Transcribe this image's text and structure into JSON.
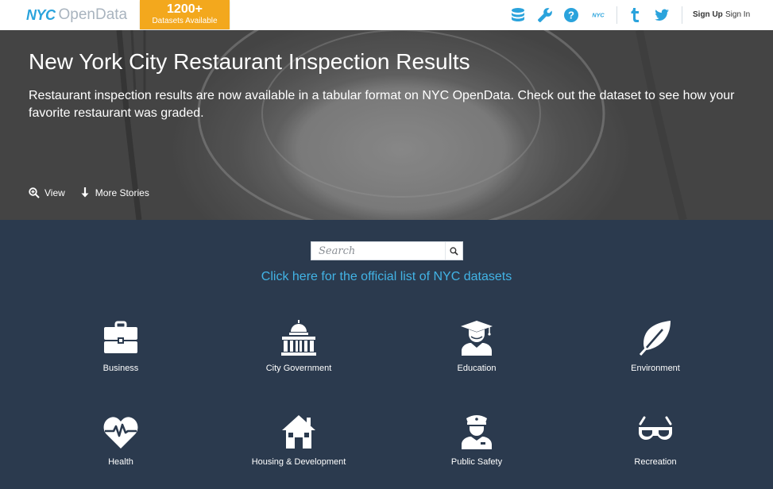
{
  "header": {
    "logo_nyc": "NYC",
    "logo_opendata": "OpenData",
    "ribbon_count": "1200+",
    "ribbon_label": "Datasets Available",
    "sign_up": "Sign Up",
    "sign_in": "Sign In",
    "icons": [
      "database-icon",
      "wrench-icon",
      "help-icon",
      "nyc-icon",
      "tumblr-icon",
      "twitter-icon"
    ],
    "nyc_icon_text": "NYC"
  },
  "hero": {
    "title": "New York City Restaurant Inspection Results",
    "description": "Restaurant inspection results are now available in a tabular format on NYC OpenData. Check out the dataset to see how your favorite restaurant was graded.",
    "view_label": "View",
    "more_stories_label": "More Stories"
  },
  "search": {
    "placeholder": "Search"
  },
  "datasets_link": "Click here for the official list of NYC datasets",
  "categories": [
    {
      "label": "Business",
      "icon": "briefcase-icon"
    },
    {
      "label": "City Government",
      "icon": "capitol-icon"
    },
    {
      "label": "Education",
      "icon": "graduate-icon"
    },
    {
      "label": "Environment",
      "icon": "leaf-icon"
    },
    {
      "label": "Health",
      "icon": "heart-pulse-icon"
    },
    {
      "label": "Housing & Development",
      "icon": "house-icon"
    },
    {
      "label": "Public Safety",
      "icon": "police-officer-icon"
    },
    {
      "label": "Recreation",
      "icon": "goggles-icon"
    }
  ],
  "colors": {
    "brand_blue": "#2aa3dc",
    "ribbon_orange": "#f3a81d",
    "navy_background": "#2b3a4e",
    "link_blue": "#42b3e5"
  }
}
